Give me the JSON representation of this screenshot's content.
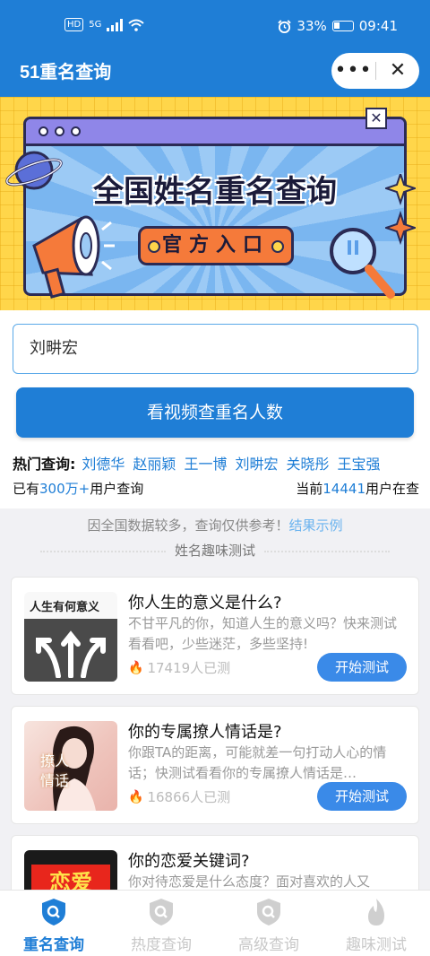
{
  "status_bar": {
    "left_badges": [
      "HD",
      "5G"
    ],
    "battery": "33%",
    "time": "09:41",
    "battery_level": 0.33
  },
  "nav": {
    "title": "51重名查询"
  },
  "banner": {
    "title": "全国姓名重名查询",
    "subtitle": "官方入口"
  },
  "search": {
    "value": "刘畊宏",
    "button": "看视频查重名人数"
  },
  "hot": {
    "label": "热门查询:",
    "items": [
      "刘德华",
      "赵丽颖",
      "王一博",
      "刘畊宏",
      "关晓彤",
      "王宝强"
    ]
  },
  "stats": {
    "left_prefix": "已有",
    "left_num": "300万+",
    "left_suffix": "用户查询",
    "right_prefix": "当前",
    "right_num": "14441",
    "right_suffix": "用户在查"
  },
  "notice": {
    "text": "因全国数据较多，查询仅供参考！",
    "link": "结果示例"
  },
  "section_title": "姓名趣味测试",
  "cards": [
    {
      "thumb_text": "人生有何意义",
      "title": "你人生的意义是什么?",
      "desc": "不甘平凡的你，知道人生的意义吗？快来测试看看吧，少些迷茫，多些坚持!",
      "count": "17419人已测",
      "button": "开始测试"
    },
    {
      "thumb_text": "撩人情话",
      "title": "你的专属撩人情话是?",
      "desc": "你跟TA的距离，可能就差一句打动人心的情话；快测试看看你的专属撩人情话是…",
      "count": "16866人已测",
      "button": "开始测试"
    },
    {
      "thumb_text": "恋爱",
      "title": "你的恋爱关键词?",
      "desc": "你对待恋爱是什么态度？面对喜欢的人又",
      "count": "",
      "button": ""
    }
  ],
  "tabs": [
    {
      "label": "重名查询",
      "active": true
    },
    {
      "label": "热度查询",
      "active": false
    },
    {
      "label": "高级查询",
      "active": false
    },
    {
      "label": "趣味测试",
      "active": false
    }
  ],
  "colors": {
    "primary": "#1f7ed6",
    "button": "#3a8ae8",
    "banner_bg": "#ffd64a",
    "flame": "#e84a3a"
  }
}
